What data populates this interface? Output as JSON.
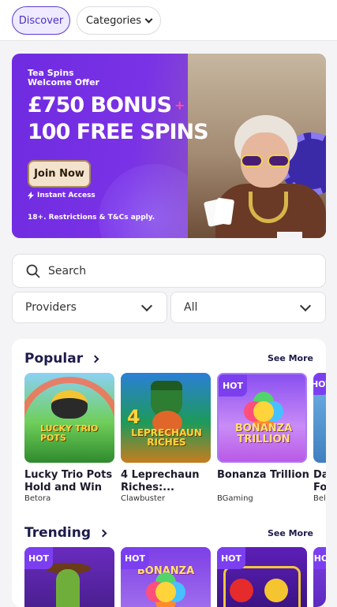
{
  "nav": {
    "discover": "Discover",
    "categories": "Categories"
  },
  "banner": {
    "title_line1": "Tea Spins",
    "title_line2": "Welcome Offer",
    "bonus_line1": "£750 BONUS",
    "plus": "+",
    "bonus_line2": "100 FREE SPINS",
    "join": "Join Now",
    "instant": "Instant Access",
    "terms": "18+. Restrictions & T&Cs apply."
  },
  "search": {
    "label": "Search"
  },
  "filters": {
    "providers": "Providers",
    "all": "All"
  },
  "popular": {
    "heading": "Popular",
    "see_more": "See More",
    "games": [
      {
        "name": "Lucky Trio Pots Hold and Win",
        "provider": "Betora",
        "hot": "",
        "art": "LUCKY TRIO POTS"
      },
      {
        "name": "4 Leprechaun Riches:...",
        "provider": "Clawbuster",
        "hot": "",
        "art": "LEPRECHAUN RICHES",
        "art_num": "4"
      },
      {
        "name": "Bonanza Trillion",
        "provider": "BGaming",
        "hot": "HOT",
        "art": "BONANZA TRILLION"
      },
      {
        "name": "Da Fo",
        "provider": "Bel",
        "hot": "HOT",
        "art": ""
      }
    ]
  },
  "trending": {
    "heading": "Trending",
    "see_more": "See More",
    "games": [
      {
        "hot": "HOT"
      },
      {
        "hot": "HOT",
        "art": "BONANZA"
      },
      {
        "hot": "HOT"
      },
      {
        "hot": "HO"
      }
    ]
  },
  "colors": {
    "accent": "#5a3bd0",
    "banner_purple": "#6f2be0",
    "heading": "#1c1b4a",
    "hot_badge": "#7b3ff0"
  }
}
